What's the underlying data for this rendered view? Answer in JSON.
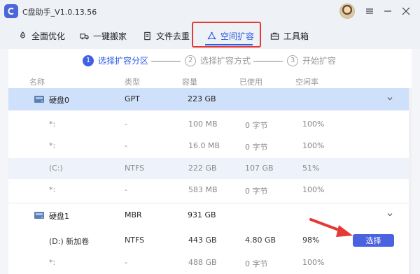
{
  "window": {
    "title": "C盘助手_V1.0.13.56"
  },
  "toolbar": {
    "items": [
      {
        "label": "全面优化",
        "icon": "rocket-icon"
      },
      {
        "label": "一键搬家",
        "icon": "truck-icon"
      },
      {
        "label": "文件去重",
        "icon": "file-icon"
      },
      {
        "label": "空间扩容",
        "icon": "expand-icon",
        "active": true
      },
      {
        "label": "工具箱",
        "icon": "toolbox-icon"
      }
    ]
  },
  "stepper": {
    "steps": [
      {
        "num": "1",
        "label": "选择扩容分区",
        "active": true
      },
      {
        "num": "2",
        "label": "选择扩容方式",
        "active": false
      },
      {
        "num": "3",
        "label": "开始扩容",
        "active": false
      }
    ]
  },
  "table": {
    "headers": [
      "名称",
      "类型",
      "容量",
      "已使用",
      "空闲率"
    ],
    "disks": [
      {
        "name": "硬盘0",
        "type": "GPT",
        "capacity": "223 GB",
        "partitions": [
          {
            "name": "*:",
            "type": "-",
            "capacity": "100 MB",
            "used": "0 字节",
            "free": "100%"
          },
          {
            "name": "*:",
            "type": "-",
            "capacity": "16.0 MB",
            "used": "0 字节",
            "free": "100%"
          },
          {
            "name": "(C:)",
            "type": "NTFS",
            "capacity": "222 GB",
            "used": "107 GB",
            "free": "51%"
          },
          {
            "name": "*:",
            "type": "-",
            "capacity": "583 MB",
            "used": "0 字节",
            "free": "100%"
          }
        ]
      },
      {
        "name": "硬盘1",
        "type": "MBR",
        "capacity": "931 GB",
        "partitions": [
          {
            "name": "(D:) 新加卷",
            "type": "NTFS",
            "capacity": "443 GB",
            "used": "4.80 GB",
            "free": "98%",
            "action": "选择"
          },
          {
            "name": "*:",
            "type": "-",
            "capacity": "488 GB",
            "used": "0 字节",
            "free": "100%"
          }
        ]
      }
    ]
  },
  "colors": {
    "accent": "#2b5ce6",
    "button": "#4a62e0",
    "selected_row": "#cfe0fa",
    "highlight": "#e53935"
  }
}
